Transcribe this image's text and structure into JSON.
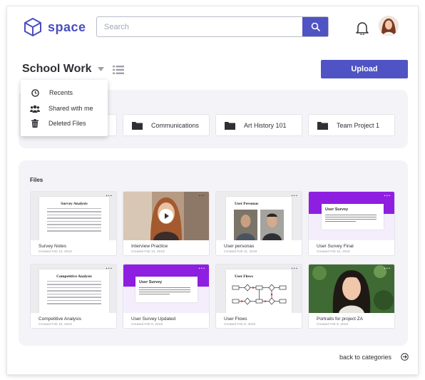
{
  "app": {
    "logo_text": "space"
  },
  "search": {
    "placeholder": "Search"
  },
  "folder": {
    "title": "School Work"
  },
  "toolbar": {
    "upload_label": "Upload"
  },
  "dropdown": {
    "items": [
      {
        "label": "Recents",
        "icon": "clock-icon"
      },
      {
        "label": "Shared with me",
        "icon": "people-icon"
      },
      {
        "label": "Deleted Files",
        "icon": "trash-icon"
      }
    ]
  },
  "categories": [
    {
      "label": "Communications"
    },
    {
      "label": "Art History 101"
    },
    {
      "label": "Team Project 1"
    }
  ],
  "files": {
    "section_label": "Files",
    "items": [
      {
        "name": "Survey Notes",
        "date": "Created Feb 13, 2018",
        "doc_title": "Survey Analysis"
      },
      {
        "name": "Interview Practice",
        "date": "Created Feb 13, 2018"
      },
      {
        "name": "User personas",
        "date": "Created Feb 11, 2018",
        "doc_title": "User Personas"
      },
      {
        "name": "User Survey Final",
        "date": "Created Feb 10, 2018",
        "doc_title": "User Survey"
      },
      {
        "name": "Competitive Analysis",
        "date": "Created Feb 10, 2018",
        "doc_title": "Competitive Analysis"
      },
      {
        "name": "User Survey Updated",
        "date": "Created Feb 9, 2018",
        "doc_title": "User Survey"
      },
      {
        "name": "User Flows",
        "date": "Created Feb 9, 2018",
        "doc_title": "User Flows"
      },
      {
        "name": "Portraits for project ZA",
        "date": "Created Feb 9, 2018"
      }
    ]
  },
  "footer": {
    "back_label": "back to categories"
  },
  "colors": {
    "accent": "#4f53c3",
    "panel": "#f3f3f8",
    "survey_purple": "#8f1fe0"
  }
}
